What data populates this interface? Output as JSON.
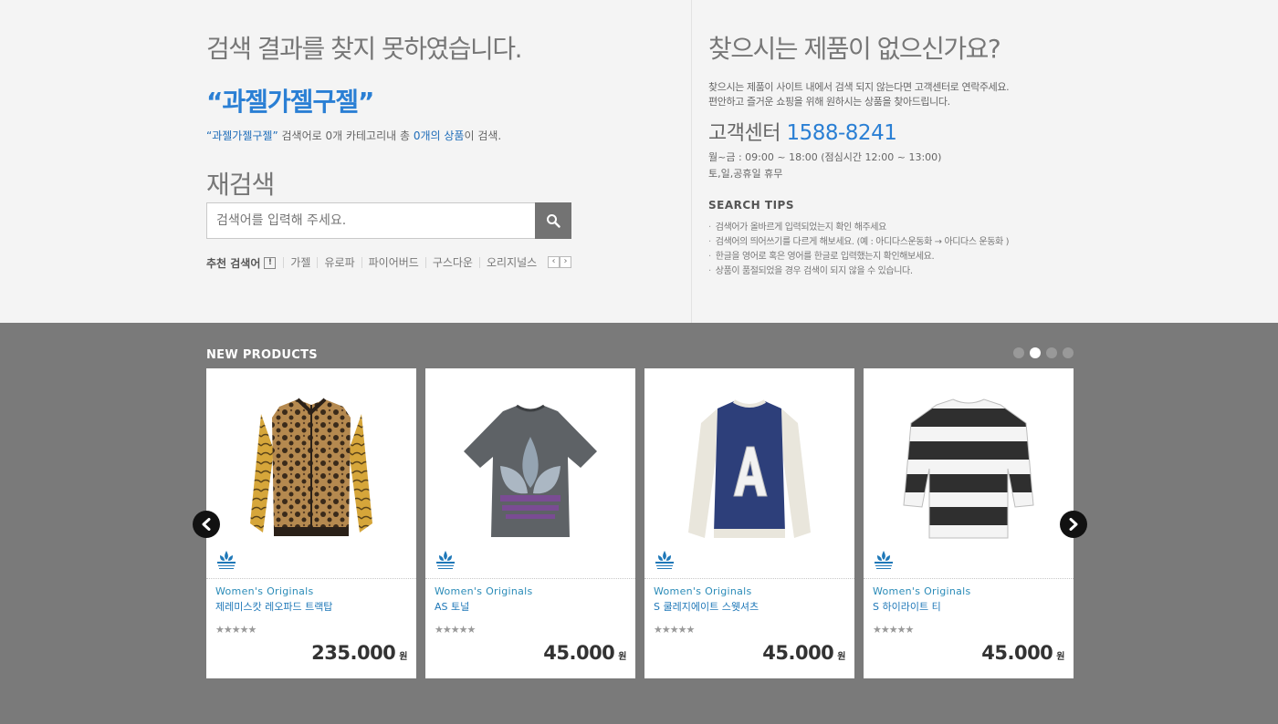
{
  "result": {
    "no_result_title": "검색 결과를 찾지 못하였습니다.",
    "query": "“과젤가젤구젤”",
    "summary_query": "“과젤가젤구젤”",
    "summary_mid": " 검색어로 0개 카테고리내 총 ",
    "summary_count": "0개의 상품",
    "summary_end": "이 검색.",
    "research_title": "재검색"
  },
  "search": {
    "placeholder": "검색어를 입력해 주세요."
  },
  "recommend": {
    "label": "추천 검색어",
    "badge": "!",
    "keywords": [
      "가젤",
      "유로파",
      "파이어버드",
      "구스다운",
      "오리지널스"
    ],
    "prev": "‹",
    "next": "›"
  },
  "help": {
    "title": "찾으시는 제품이 없으신가요?",
    "desc_line1": "찾으시는 제품이 사이트 내에서 검색 되지 않는다면 고객센터로 연락주세요.",
    "desc_line2": "편안하고 즐거운 쇼핑을 위해 원하시는 상품을 찾아드립니다.",
    "cs_label": "고객센터",
    "cs_phone": "1588-8241",
    "hours_weekday": "월~금 : 09:00 ~ 18:00 (점심시간 12:00 ~ 13:00)",
    "hours_weekend": "토,일,공휴일 휴무",
    "tips_title": "SEARCH TIPS",
    "tips": [
      "검색어가 올바르게 입력되었는지 확인 해주세요",
      "검색어의 띄어쓰기를 다르게 해보세요. (예 : 아디다스운동화 → 아디다스 운동화 )",
      "한글을 영어로 혹은 영어를 한글로 입력했는지 확인해보세요.",
      "상품이 품절되었을 경우 검색이 되지 않을 수 있습니다."
    ]
  },
  "new_products": {
    "title": "NEW PRODUCTS",
    "page_count": 4,
    "active_page": 1,
    "currency": "원",
    "items": [
      {
        "category": "Women's Originals",
        "name": "제레미스캇 레오파드 트랙탑",
        "rating_stars": "★★★★★",
        "price": "235.000",
        "image_icon": "leopard-track-jacket"
      },
      {
        "category": "Women's Originals",
        "name": "AS 토널",
        "rating_stars": "★★★★★",
        "price": "45.000",
        "image_icon": "trefoil-tee"
      },
      {
        "category": "Women's Originals",
        "name": "S 쿨레지에이트 스웻셔츠",
        "rating_stars": "★★★★★",
        "price": "45.000",
        "image_icon": "collegiate-sweatshirt"
      },
      {
        "category": "Women's Originals",
        "name": "S 하이라이트 티",
        "rating_stars": "★★★★★",
        "price": "45.000",
        "image_icon": "striped-tee"
      }
    ]
  },
  "colors": {
    "accent_blue": "#2a7fd4",
    "link_blue": "#1f78b8",
    "products_bg": "#7a7a7a",
    "page_bg": "#f4f4f4"
  }
}
